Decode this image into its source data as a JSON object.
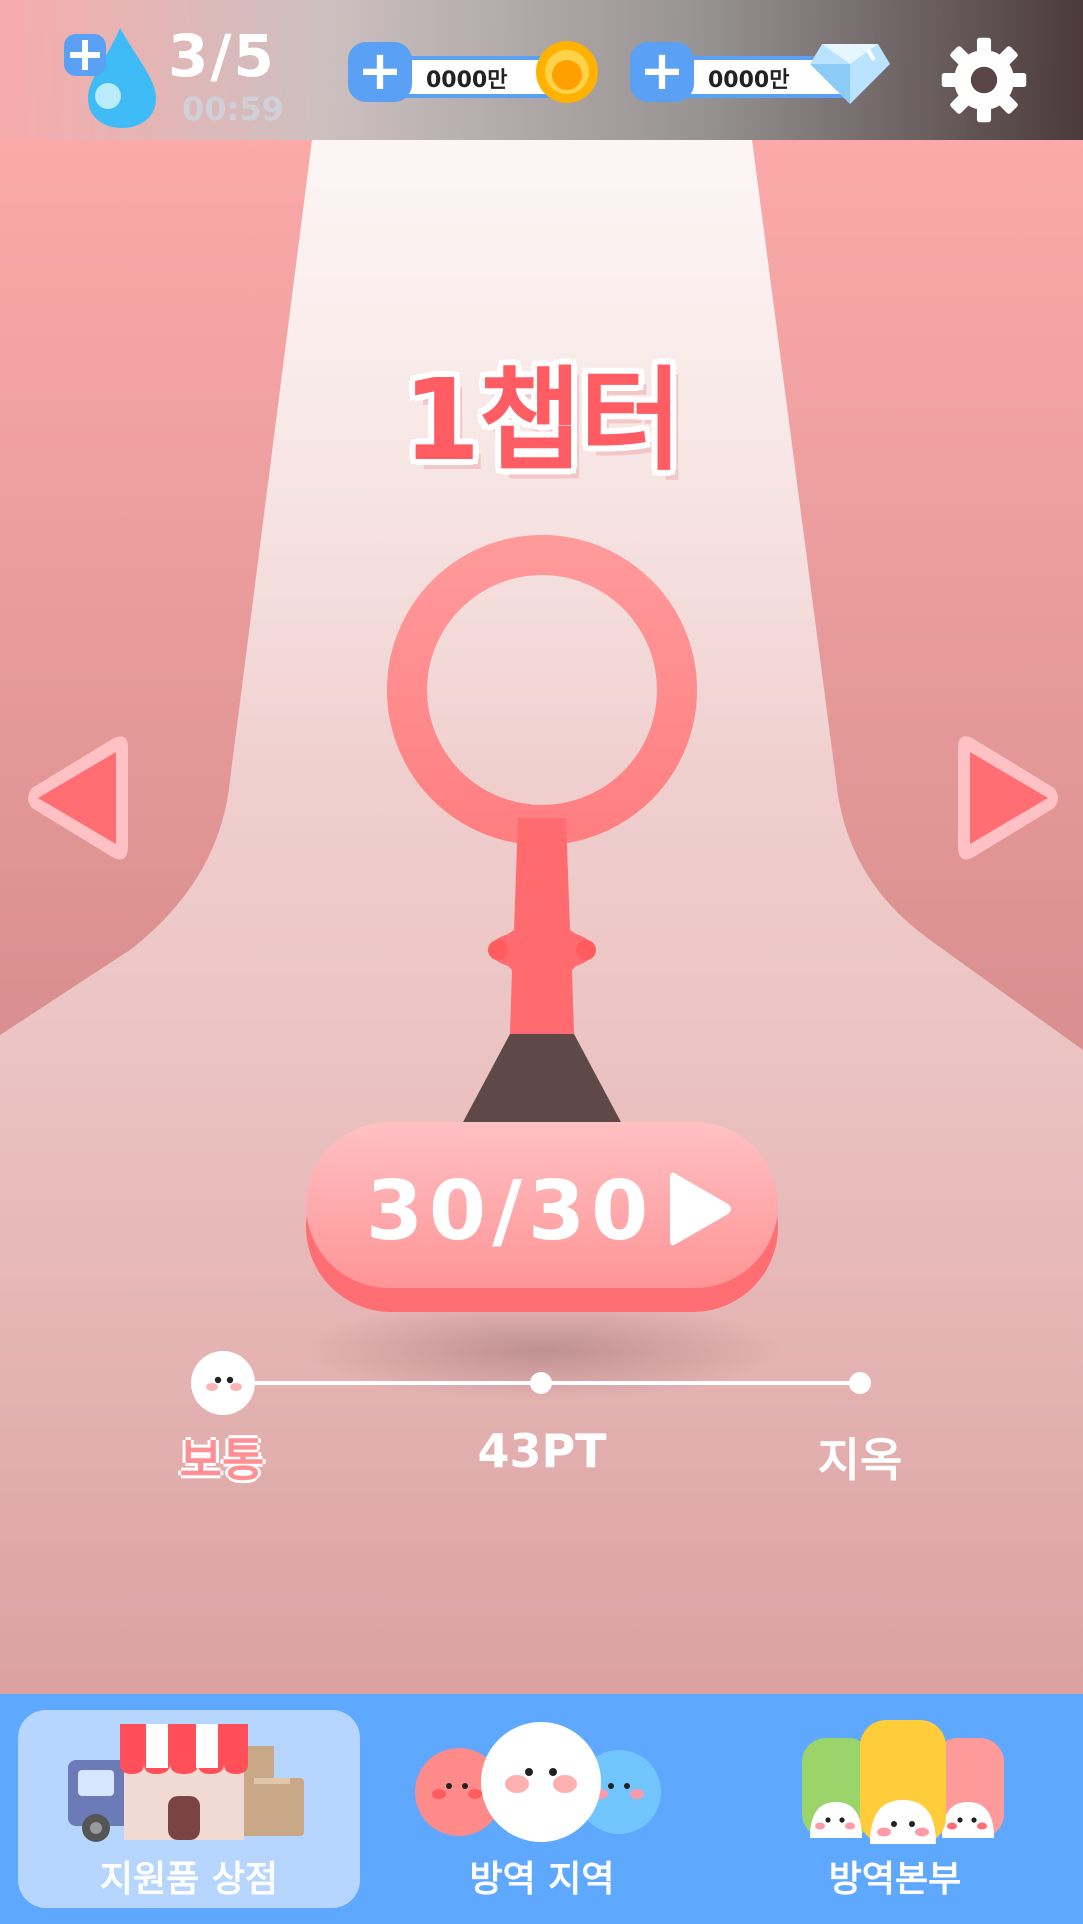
{
  "header": {
    "lives": {
      "count": "3/5",
      "timer": "00:59",
      "icon": "water-drop-icon"
    },
    "coins": {
      "amount": "0000만",
      "icon": "coin-icon"
    },
    "gems": {
      "amount": "0000만",
      "icon": "diamond-icon"
    },
    "settings_icon": "gear-icon"
  },
  "stage": {
    "chapter_title": "1챕터",
    "play_label": "30/30"
  },
  "difficulty": {
    "levels": [
      "보통",
      "43PT",
      "지옥"
    ],
    "selected_index": 0
  },
  "bottom_nav": {
    "tabs": [
      {
        "label": "지원품 상점",
        "icon": "shop-icon",
        "active": true
      },
      {
        "label": "방역 지역",
        "icon": "area-characters-icon",
        "active": false
      },
      {
        "label": "방역본부",
        "icon": "headquarters-icon",
        "active": false
      }
    ]
  },
  "colors": {
    "accent_blue": "#5ea8ff",
    "pink": "#ff6e72",
    "light_pink": "#ffc1c4"
  }
}
